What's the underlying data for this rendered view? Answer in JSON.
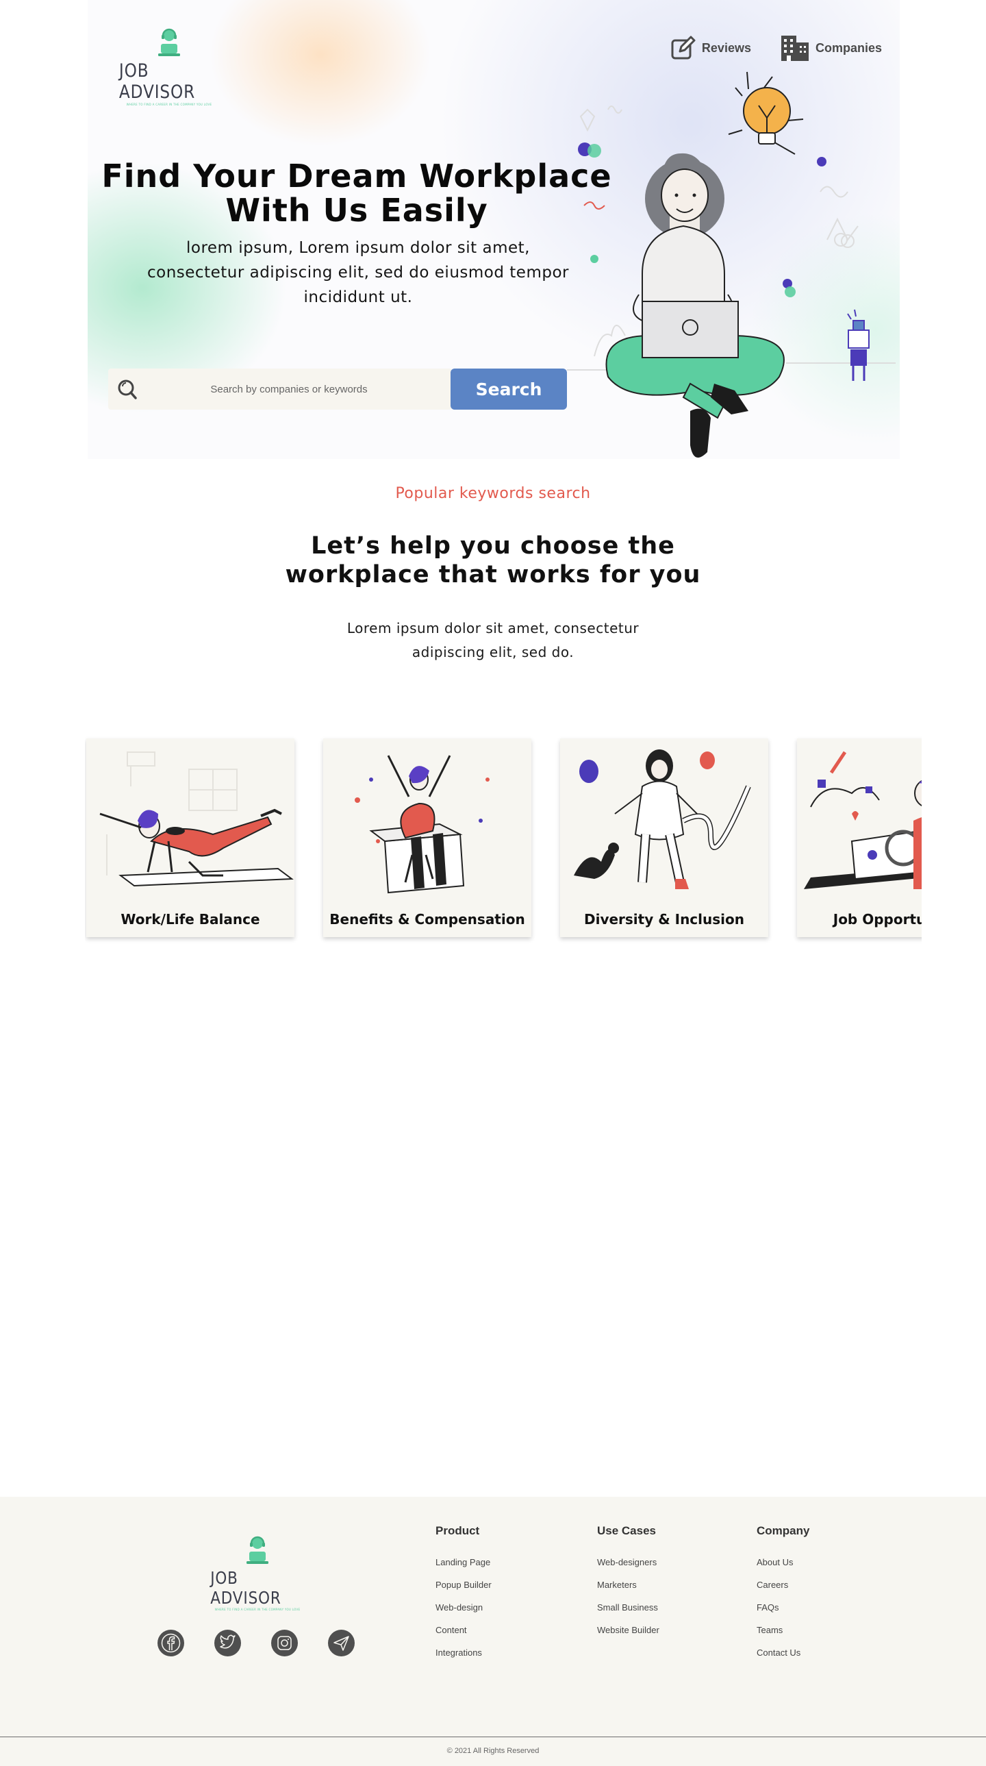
{
  "brand": {
    "name": "JOB ADVISOR",
    "tagline": "WHERE TO FIND A CAREER IN THE COMPANY YOU LOVE",
    "accent": "#5ccea0"
  },
  "nav": [
    {
      "label": "Reviews",
      "icon": "edit-icon"
    },
    {
      "label": "Companies",
      "icon": "building-icon"
    }
  ],
  "hero": {
    "title_line1": "Find Your Dream Workplace",
    "title_line2": "With Us Easily",
    "subtitle": "lorem ipsum, Lorem ipsum dolor sit amet, consectetur adipiscing elit, sed do eiusmod tempor incididunt ut.",
    "search_placeholder": "Search by companies or keywords",
    "search_button": "Search",
    "button_color": "#5b84c5"
  },
  "section": {
    "kicker": "Popular keywords search",
    "kicker_color": "#e25a4e",
    "title_line1": "Let’s help you choose the",
    "title_line2": "workplace that works for you",
    "subtitle_line1": "Lorem ipsum dolor sit amet, consectetur",
    "subtitle_line2": "adipiscing elit, sed do."
  },
  "cards": [
    {
      "label": "Work/Life Balance"
    },
    {
      "label": "Benefits & Compensation"
    },
    {
      "label": "Diversity & Inclusion"
    },
    {
      "label": "Job Opportunities"
    }
  ],
  "footer": {
    "social": [
      "facebook-icon",
      "twitter-icon",
      "instagram-icon",
      "send-icon"
    ],
    "columns": [
      {
        "title": "Product",
        "links": [
          "Landing Page",
          "Popup Builder",
          "Web-design",
          "Content",
          "Integrations"
        ]
      },
      {
        "title": "Use Cases",
        "links": [
          "Web-designers",
          "Marketers",
          "Small Business",
          "Website Builder"
        ]
      },
      {
        "title": "Company",
        "links": [
          "About Us",
          "Careers",
          "FAQs",
          "Teams",
          "Contact Us"
        ]
      }
    ],
    "copyright": "© 2021 All Rights Reserved"
  }
}
